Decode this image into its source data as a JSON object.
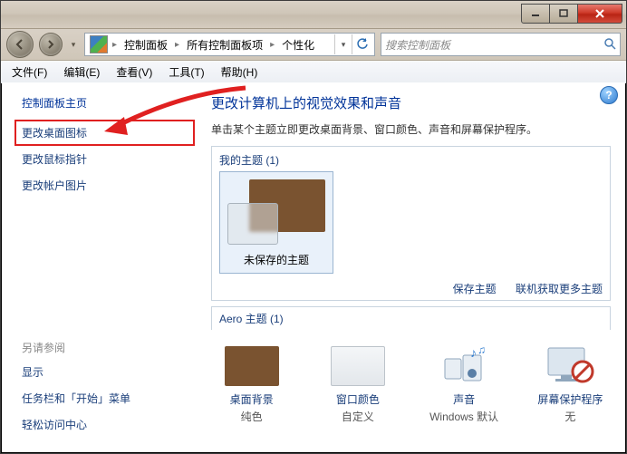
{
  "window_controls": {
    "min": "—",
    "max": "□",
    "close": "×"
  },
  "breadcrumb": {
    "items": [
      "控制面板",
      "所有控制面板项",
      "个性化"
    ]
  },
  "search": {
    "placeholder": "搜索控制面板"
  },
  "menu": {
    "file": "文件(F)",
    "edit": "编辑(E)",
    "view": "查看(V)",
    "tools": "工具(T)",
    "help": "帮助(H)"
  },
  "sidebar": {
    "home": "控制面板主页",
    "links": [
      "更改桌面图标",
      "更改鼠标指针",
      "更改帐户图片"
    ],
    "see_also_header": "另请参阅",
    "see_also": [
      "显示",
      "任务栏和「开始」菜单",
      "轻松访问中心"
    ]
  },
  "main": {
    "title": "更改计算机上的视觉效果和声音",
    "subtitle": "单击某个主题立即更改桌面背景、窗口颜色、声音和屏幕保护程序。",
    "my_themes_header": "我的主题 (1)",
    "unsaved_theme": "未保存的主题",
    "save_theme": "保存主题",
    "get_more": "联机获取更多主题",
    "aero_header": "Aero 主题 (1)"
  },
  "tiles": {
    "bg": {
      "label": "桌面背景",
      "value": "纯色"
    },
    "color": {
      "label": "窗口颜色",
      "value": "自定义"
    },
    "sound": {
      "label": "声音",
      "value": "Windows 默认"
    },
    "saver": {
      "label": "屏幕保护程序",
      "value": "无"
    }
  }
}
